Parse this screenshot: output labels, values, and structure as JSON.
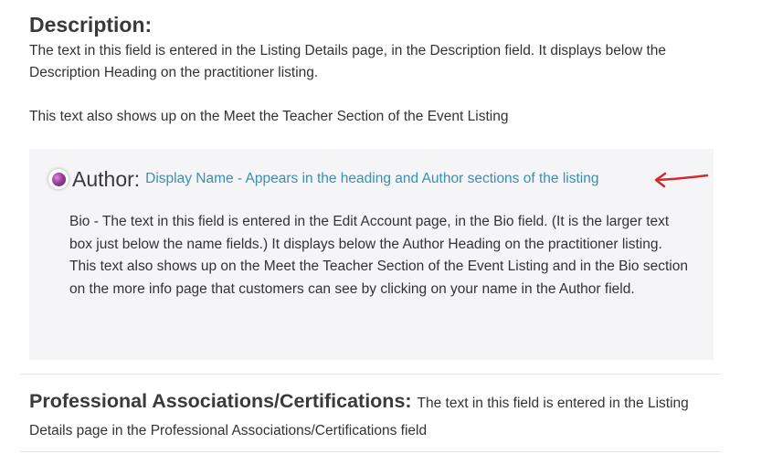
{
  "description": {
    "heading": "Description:",
    "text": "The text in this field is entered in the Listing Details page, in the Description field. It displays below the Description Heading on the practitioner listing.",
    "text2": "This text also shows up on the Meet the Teacher Section of the Event Listing"
  },
  "author": {
    "label": "Author:",
    "name": "Display Name - Appears in the heading and Author sections of the listing",
    "bio": "Bio - The text in this field is entered in the Edit Account page, in the Bio field. (It is the larger text box just below the name fields.) It displays below the Author Heading on the practitioner listing. This text also shows up on the Meet the Teacher Section of the Event Listing and in the Bio section on the more info page that customers can see by clicking on your name in the Author field.",
    "arrow_color": "#d42a2a",
    "avatar_icon": "avatar-icon"
  },
  "professional": {
    "heading": "Professional Associations/Certifications:",
    "text": "The text in this field is entered in the Listing Details page in the Professional Associations/Certifications field"
  },
  "colors": {
    "link": "#3b8fb0",
    "heading": "#3a3a3a",
    "box_background": "#f5f5f7"
  }
}
